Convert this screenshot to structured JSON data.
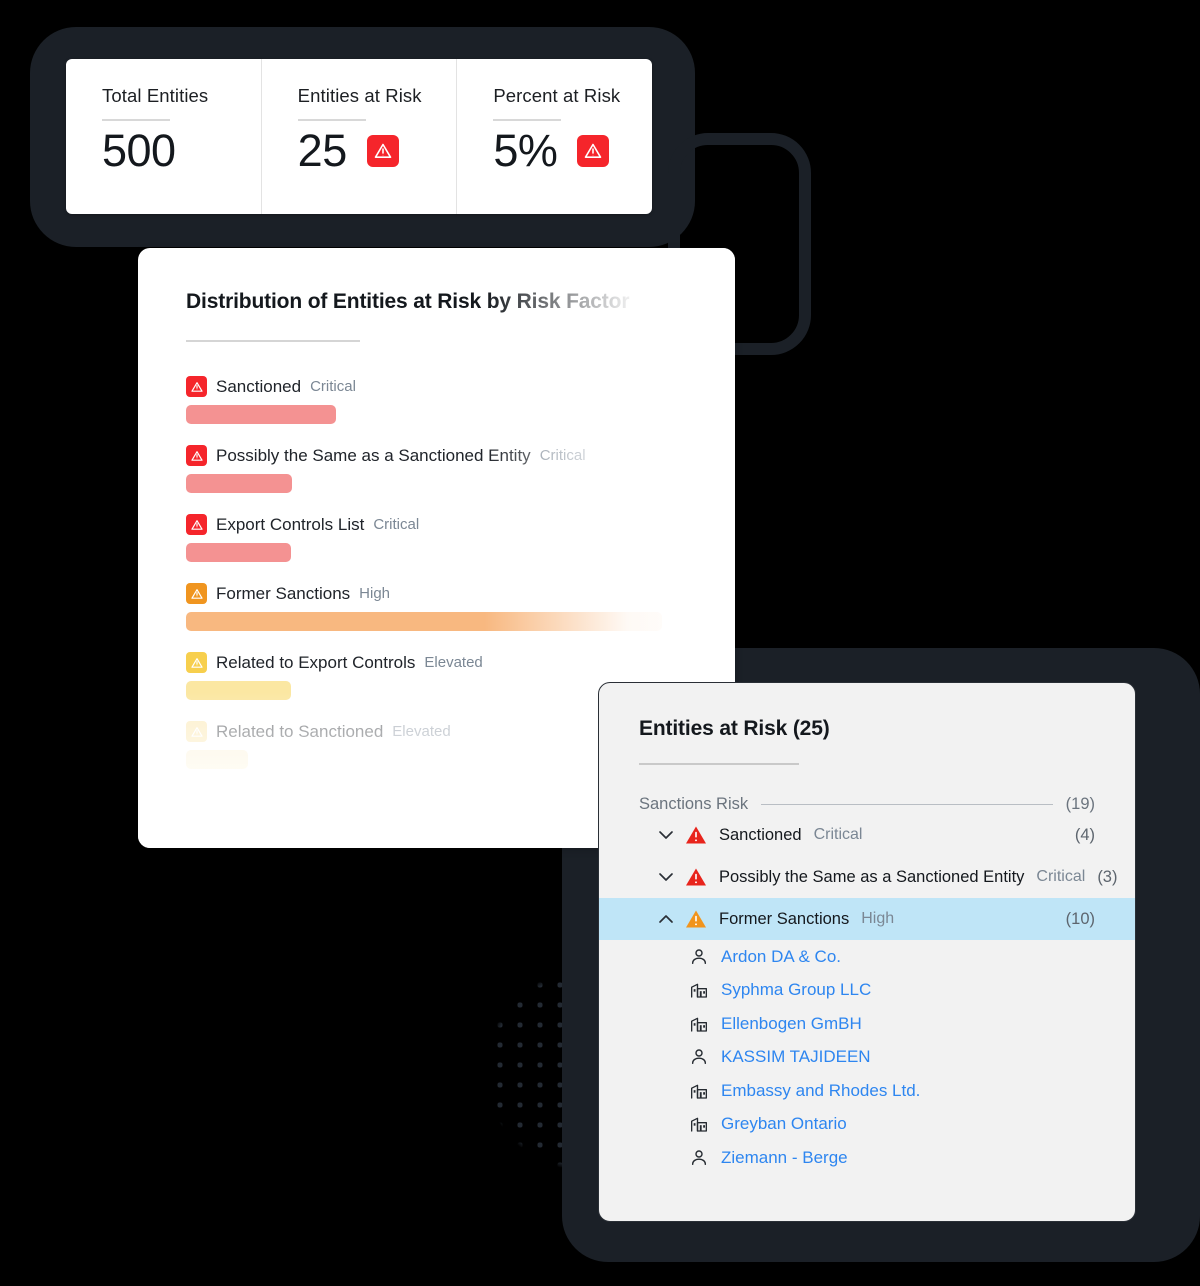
{
  "kpi": {
    "cards": [
      {
        "label": "Total Entities",
        "value": "500",
        "alert": false,
        "alert_icon": "warning-triangle-icon"
      },
      {
        "label": "Entities at Risk",
        "value": "25",
        "alert": true,
        "alert_icon": "warning-triangle-icon"
      },
      {
        "label": "Percent at Risk",
        "value": "5%",
        "alert": true,
        "alert_icon": "warning-triangle-icon"
      }
    ]
  },
  "chart_panel": {
    "title": "Distribution of Entities at Risk by Risk Factor"
  },
  "chart_data": {
    "type": "bar",
    "title": "Distribution of Entities at Risk by Risk Factor",
    "orientation": "horizontal",
    "xlabel": "",
    "ylabel": "",
    "grid": false,
    "legend": "none",
    "categories": [
      "Sanctioned",
      "Possibly the Same as a Sanctioned Entity",
      "Export Controls List",
      "Former Sanctions",
      "Related to Export Controls",
      "Related to Sanctioned"
    ],
    "severities": [
      "Critical",
      "Critical",
      "Critical",
      "High",
      "Elevated",
      "Elevated"
    ],
    "values": [
      150,
      106,
      105,
      476,
      105,
      62
    ],
    "value_unit": "px-width",
    "colors": [
      "#f49292",
      "#f49292",
      "#f49292",
      "#f8b880",
      "#fbe7a2",
      "#fdf0cb"
    ],
    "badge_colors": [
      "#f5252b",
      "#f5252b",
      "#f5252b",
      "#f0951f",
      "#f7cf4d",
      "#fbe3a0"
    ],
    "faded": [
      false,
      false,
      false,
      false,
      false,
      true
    ]
  },
  "entities_panel": {
    "title": "Entities at Risk (25)",
    "group": {
      "name": "Sanctions Risk",
      "count": "(19)"
    },
    "risk_rows": [
      {
        "name": "Sanctioned",
        "severity": "Critical",
        "count": "(4)",
        "expanded": false,
        "chevron": "chevron-down-icon",
        "color": "#e8241c"
      },
      {
        "name": "Possibly the Same as a Sanctioned Entity",
        "severity": "Critical",
        "count": "(3)",
        "expanded": false,
        "chevron": "chevron-down-icon",
        "color": "#e8241c"
      },
      {
        "name": "Former Sanctions",
        "severity": "High",
        "count": "(10)",
        "expanded": true,
        "chevron": "chevron-up-icon",
        "color": "#f1941c"
      }
    ],
    "entities": [
      {
        "name": "Ardon DA & Co.",
        "icon": "person-icon"
      },
      {
        "name": "Syphma Group LLC",
        "icon": "building-icon"
      },
      {
        "name": "Ellenbogen GmBH",
        "icon": "building-icon"
      },
      {
        "name": "KASSIM TAJIDEEN",
        "icon": "person-icon"
      },
      {
        "name": "Embassy and Rhodes Ltd.",
        "icon": "building-icon"
      },
      {
        "name": "Greyban Ontario",
        "icon": "building-icon"
      },
      {
        "name": "Ziemann - Berge",
        "icon": "person-icon"
      }
    ]
  },
  "theme": {
    "background": "#000000",
    "slab": "#1b2027",
    "link": "#2e86f0",
    "selected_row": "#bfe5f7",
    "critical": "#f5252b",
    "high": "#f0951f",
    "elevated": "#f7cf4d"
  }
}
